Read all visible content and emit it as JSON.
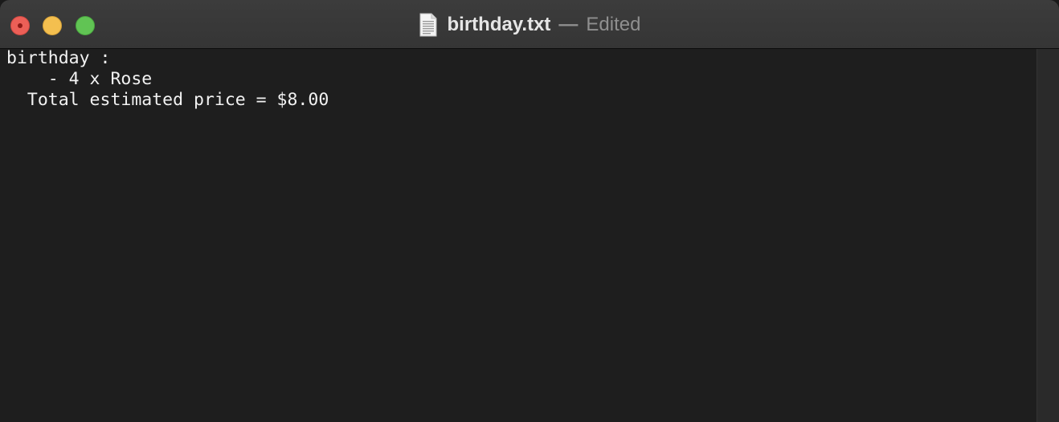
{
  "window": {
    "filename": "birthday.txt",
    "separator": "—",
    "status": "Edited",
    "file_icon": "text-document-icon"
  },
  "controls": {
    "close_icon": "close-icon",
    "minimize_icon": "minimize-icon",
    "zoom_icon": "zoom-icon",
    "colors": {
      "close": "#ec5f57",
      "minimize": "#f4bf4f",
      "zoom": "#61c454"
    }
  },
  "document": {
    "lines": [
      "birthday :",
      "    - 4 x Rose",
      "  Total estimated price = $8.00"
    ]
  },
  "theme": {
    "background": "#1e1e1e",
    "text": "#f2f2f2"
  }
}
